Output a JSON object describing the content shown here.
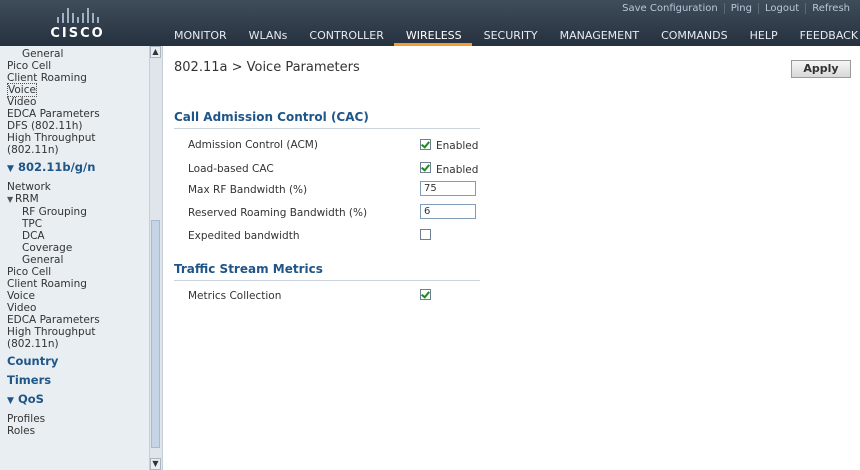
{
  "header": {
    "logo_text": "CISCO",
    "util_links": [
      "Save Configuration",
      "Ping",
      "Logout",
      "Refresh"
    ],
    "nav": [
      "MONITOR",
      "WLANs",
      "CONTROLLER",
      "WIRELESS",
      "SECURITY",
      "MANAGEMENT",
      "COMMANDS",
      "HELP",
      "FEEDBACK"
    ],
    "active_nav": "WIRELESS"
  },
  "sidebar": {
    "items": [
      {
        "label": "General",
        "level": "l2"
      },
      {
        "label": "Pico Cell",
        "level": "l1"
      },
      {
        "label": "Client Roaming",
        "level": "l1"
      },
      {
        "label": "Voice",
        "level": "l1",
        "selected": true
      },
      {
        "label": "Video",
        "level": "l1"
      },
      {
        "label": "EDCA Parameters",
        "level": "l1"
      },
      {
        "label": "DFS (802.11h)",
        "level": "l1"
      },
      {
        "label": "High Throughput\n(802.11n)",
        "level": "l1"
      },
      {
        "label": "802.11b/g/n",
        "level": "sect",
        "arrow": "▼"
      },
      {
        "label": "Network",
        "level": "l1"
      },
      {
        "label": "RRM",
        "level": "sub",
        "arrow": "▼"
      },
      {
        "label": "RF Grouping",
        "level": "l2"
      },
      {
        "label": "TPC",
        "level": "l2"
      },
      {
        "label": "DCA",
        "level": "l2"
      },
      {
        "label": "Coverage",
        "level": "l2"
      },
      {
        "label": "General",
        "level": "l2"
      },
      {
        "label": "Pico Cell",
        "level": "l1"
      },
      {
        "label": "Client Roaming",
        "level": "l1"
      },
      {
        "label": "Voice",
        "level": "l1"
      },
      {
        "label": "Video",
        "level": "l1"
      },
      {
        "label": "EDCA Parameters",
        "level": "l1"
      },
      {
        "label": "High Throughput\n(802.11n)",
        "level": "l1"
      },
      {
        "label": "Country",
        "level": "sect"
      },
      {
        "label": "Timers",
        "level": "sect"
      },
      {
        "label": "QoS",
        "level": "sect",
        "arrow": "▼"
      },
      {
        "label": "Profiles",
        "level": "l1"
      },
      {
        "label": "Roles",
        "level": "l1"
      }
    ]
  },
  "page": {
    "title": "802.11a > Voice Parameters",
    "apply_label": "Apply"
  },
  "cac": {
    "section_title": "Call Admission Control (CAC)",
    "admission_control_label": "Admission Control (ACM)",
    "admission_control_checked": true,
    "admission_control_text": "Enabled",
    "load_based_label": "Load-based CAC",
    "load_based_checked": true,
    "load_based_text": "Enabled",
    "max_rf_label": "Max RF Bandwidth (%)",
    "max_rf_value": "75",
    "reserved_label": "Reserved Roaming Bandwidth (%)",
    "reserved_value": "6",
    "expedited_label": "Expedited bandwidth",
    "expedited_checked": false
  },
  "tsm": {
    "section_title": "Traffic Stream Metrics",
    "metrics_label": "Metrics Collection",
    "metrics_checked": true
  }
}
